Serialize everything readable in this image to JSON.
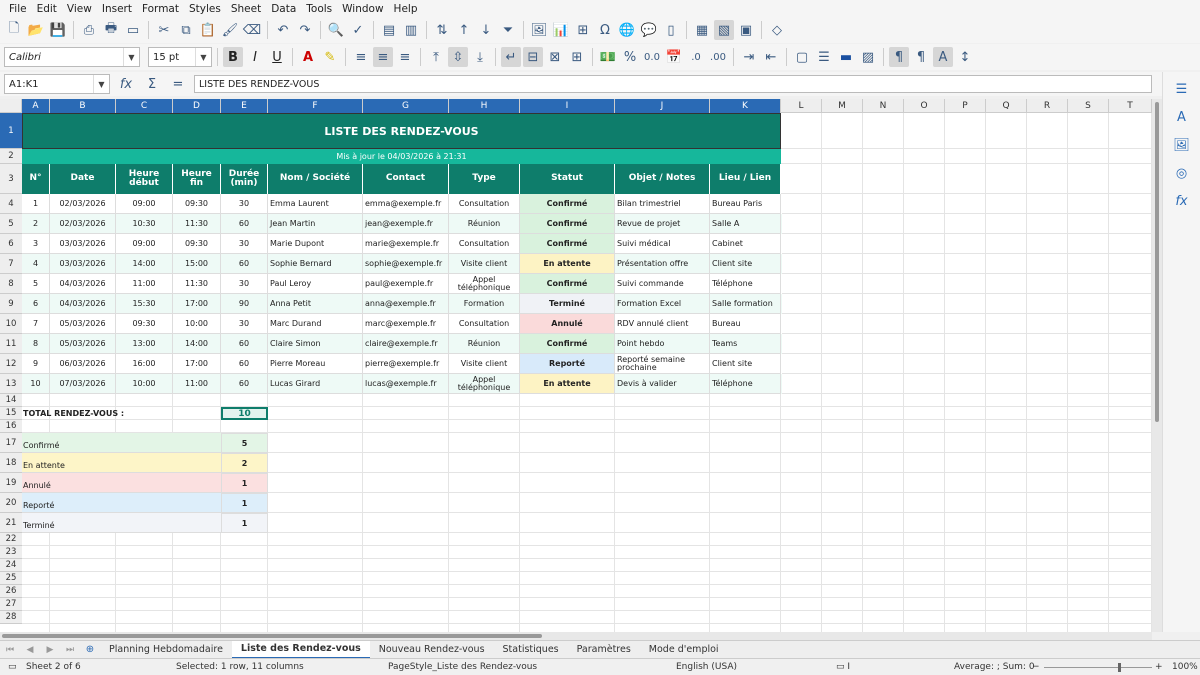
{
  "menu": [
    "File",
    "Edit",
    "View",
    "Insert",
    "Format",
    "Styles",
    "Sheet",
    "Data",
    "Tools",
    "Window",
    "Help"
  ],
  "font": {
    "name": "Calibri",
    "size": "15 pt"
  },
  "name_box": "A1:K1",
  "formula": "LISTE DES RENDEZ-VOUS",
  "columns": [
    "A",
    "B",
    "C",
    "D",
    "E",
    "F",
    "G",
    "H",
    "I",
    "J",
    "K",
    "L",
    "M",
    "N",
    "O",
    "P",
    "Q",
    "R",
    "S",
    "T"
  ],
  "rows": [
    "1",
    "2",
    "3",
    "4",
    "5",
    "6",
    "7",
    "8",
    "9",
    "10",
    "11",
    "12",
    "13",
    "14",
    "15",
    "16",
    "17",
    "18",
    "19",
    "20",
    "21",
    "22",
    "23",
    "24",
    "25",
    "26",
    "27",
    "28"
  ],
  "title": "LISTE DES RENDEZ-VOUS",
  "subtitle": "Mis à jour le 04/03/2026 à 21:31",
  "headers": [
    "N°",
    "Date",
    "Heure début",
    "Heure fin",
    "Durée (min)",
    "Nom / Société",
    "Contact",
    "Type",
    "Statut",
    "Objet / Notes",
    "Lieu / Lien"
  ],
  "appointments": [
    {
      "n": "1",
      "date": "02/03/2026",
      "start": "09:00",
      "end": "09:30",
      "dur": "30",
      "name": "Emma Laurent",
      "contact": "emma@exemple.fr",
      "type": "Consultation",
      "status": "Confirmé",
      "notes": "Bilan trimestriel",
      "place": "Bureau Paris"
    },
    {
      "n": "2",
      "date": "02/03/2026",
      "start": "10:30",
      "end": "11:30",
      "dur": "60",
      "name": "Jean Martin",
      "contact": "jean@exemple.fr",
      "type": "Réunion",
      "status": "Confirmé",
      "notes": "Revue de projet",
      "place": "Salle A"
    },
    {
      "n": "3",
      "date": "03/03/2026",
      "start": "09:00",
      "end": "09:30",
      "dur": "30",
      "name": "Marie Dupont",
      "contact": "marie@exemple.fr",
      "type": "Consultation",
      "status": "Confirmé",
      "notes": "Suivi médical",
      "place": "Cabinet"
    },
    {
      "n": "4",
      "date": "03/03/2026",
      "start": "14:00",
      "end": "15:00",
      "dur": "60",
      "name": "Sophie Bernard",
      "contact": "sophie@exemple.fr",
      "type": "Visite client",
      "status": "En attente",
      "notes": "Présentation offre",
      "place": "Client site"
    },
    {
      "n": "5",
      "date": "04/03/2026",
      "start": "11:00",
      "end": "11:30",
      "dur": "30",
      "name": "Paul Leroy",
      "contact": "paul@exemple.fr",
      "type": "Appel téléphonique",
      "status": "Confirmé",
      "notes": "Suivi commande",
      "place": "Téléphone"
    },
    {
      "n": "6",
      "date": "04/03/2026",
      "start": "15:30",
      "end": "17:00",
      "dur": "90",
      "name": "Anna Petit",
      "contact": "anna@exemple.fr",
      "type": "Formation",
      "status": "Terminé",
      "notes": "Formation Excel",
      "place": "Salle formation"
    },
    {
      "n": "7",
      "date": "05/03/2026",
      "start": "09:30",
      "end": "10:00",
      "dur": "30",
      "name": "Marc Durand",
      "contact": "marc@exemple.fr",
      "type": "Consultation",
      "status": "Annulé",
      "notes": "RDV annulé client",
      "place": "Bureau"
    },
    {
      "n": "8",
      "date": "05/03/2026",
      "start": "13:00",
      "end": "14:00",
      "dur": "60",
      "name": "Claire Simon",
      "contact": "claire@exemple.fr",
      "type": "Réunion",
      "status": "Confirmé",
      "notes": "Point hebdo",
      "place": "Teams"
    },
    {
      "n": "9",
      "date": "06/03/2026",
      "start": "16:00",
      "end": "17:00",
      "dur": "60",
      "name": "Pierre Moreau",
      "contact": "pierre@exemple.fr",
      "type": "Visite client",
      "status": "Reporté",
      "notes": "Reporté semaine prochaine",
      "place": "Client site"
    },
    {
      "n": "10",
      "date": "07/03/2026",
      "start": "10:00",
      "end": "11:00",
      "dur": "60",
      "name": "Lucas Girard",
      "contact": "lucas@exemple.fr",
      "type": "Appel téléphonique",
      "status": "En attente",
      "notes": "Devis à valider",
      "place": "Téléphone"
    }
  ],
  "total_label": "TOTAL RENDEZ-VOUS :",
  "total_value": "10",
  "summary": [
    {
      "label": "Confirmé",
      "value": "5",
      "color": "#e3f5e6"
    },
    {
      "label": "En attente",
      "value": "2",
      "color": "#fdf5c8"
    },
    {
      "label": "Annulé",
      "value": "1",
      "color": "#fbe0e0"
    },
    {
      "label": "Reporté",
      "value": "1",
      "color": "#ddeefa"
    },
    {
      "label": "Terminé",
      "value": "1",
      "color": "#f2f4f8"
    }
  ],
  "status_colors": {
    "Confirmé": "#d9f2dd",
    "En attente": "#fdf3c4",
    "Annulé": "#fadada",
    "Reporté": "#d8eafa",
    "Terminé": "#f0f2f6"
  },
  "tabs": [
    "Planning Hebdomadaire",
    "Liste des Rendez-vous",
    "Nouveau Rendez-vous",
    "Statistiques",
    "Paramètres",
    "Mode d'emploi"
  ],
  "active_tab": "Liste des Rendez-vous",
  "status": {
    "sheet": "Sheet 2 of 6",
    "selection": "Selected: 1 row, 11 columns",
    "page_style": "PageStyle_Liste des Rendez-vous",
    "language": "English (USA)",
    "sum": "Average: ; Sum: 0",
    "zoom": "100%"
  },
  "colors": {
    "teal_dark": "#0e7d6b",
    "teal_light": "#16b79b",
    "accent": "#2a6ab5"
  }
}
